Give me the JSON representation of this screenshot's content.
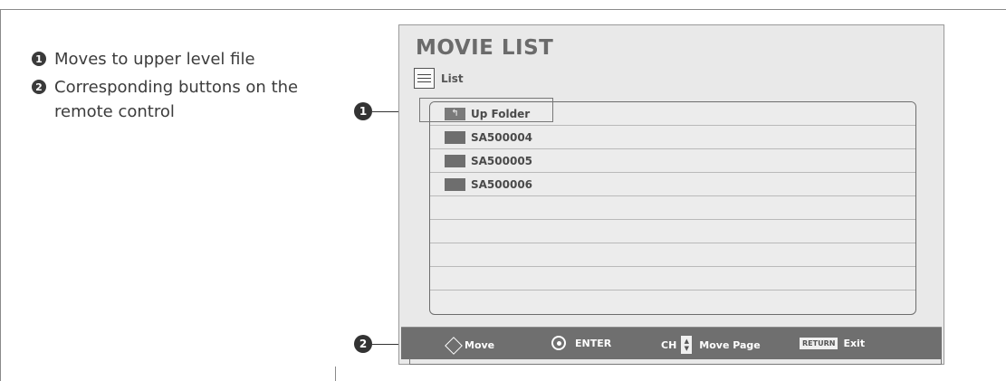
{
  "notes": [
    {
      "num": "1",
      "text": "Moves to upper level file"
    },
    {
      "num": "2",
      "text": "Corresponding buttons on the remote control"
    }
  ],
  "callouts": {
    "first": "1",
    "second": "2"
  },
  "screen": {
    "title": "MOVIE LIST",
    "view_mode": "List",
    "files": [
      {
        "name": "Up Folder",
        "icon": "up-folder-icon"
      },
      {
        "name": "SA500004",
        "icon": "folder-icon"
      },
      {
        "name": "SA500005",
        "icon": "folder-icon"
      },
      {
        "name": "SA500006",
        "icon": "folder-icon"
      }
    ],
    "empty_rows": 5
  },
  "guide": {
    "move": "Move",
    "enter": "ENTER",
    "ch": "CH",
    "move_page": "Move Page",
    "return_key": "RETURN",
    "exit": "Exit"
  }
}
